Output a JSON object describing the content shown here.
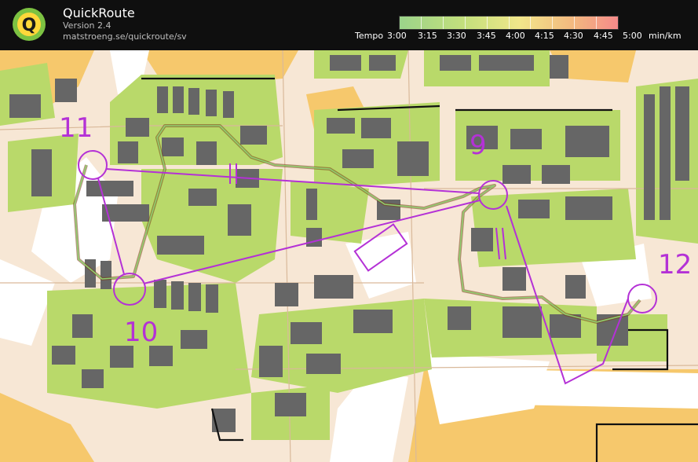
{
  "app": {
    "name": "QuickRoute",
    "version": "Version 2.4",
    "url": "matstroeng.se/quickroute/sv",
    "logo_letter": "Q"
  },
  "legend": {
    "label": "Tempo",
    "ticks": [
      "3:00",
      "3:15",
      "3:30",
      "3:45",
      "4:00",
      "4:15",
      "4:30",
      "4:45",
      "5:00"
    ],
    "unit": "min/km",
    "colors": [
      "#9bd38a",
      "#c4e07c",
      "#f1e68a",
      "#f3b77f",
      "#f48a8a"
    ]
  },
  "map": {
    "controls": [
      "9",
      "10",
      "11",
      "12"
    ],
    "colors": {
      "course": "#b431d6",
      "vegetation": "#b9d96a",
      "building": "#666666",
      "open_land": "#f6c86c",
      "paved": "#f7e7d5"
    }
  }
}
